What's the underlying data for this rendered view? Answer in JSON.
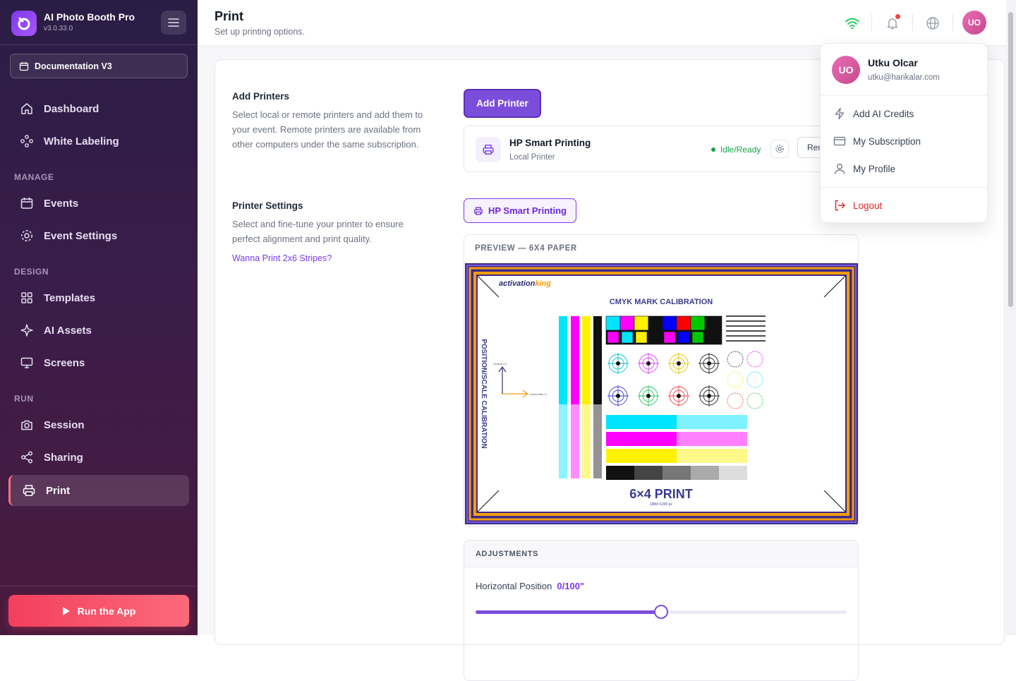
{
  "app": {
    "name": "AI Photo Booth Pro",
    "version": "v3.0.33.0"
  },
  "sidebar": {
    "project": "Documentation V3",
    "sections": {
      "manage": "MANAGE",
      "design": "DESIGN",
      "run": "RUN"
    },
    "items": [
      {
        "label": "Dashboard",
        "icon": "home-icon"
      },
      {
        "label": "White Labeling",
        "icon": "palette-icon"
      },
      {
        "label": "Events",
        "icon": "calendar-icon"
      },
      {
        "label": "Event Settings",
        "icon": "gear-icon"
      },
      {
        "label": "Templates",
        "icon": "grid-icon"
      },
      {
        "label": "AI Assets",
        "icon": "sparkle-icon"
      },
      {
        "label": "Screens",
        "icon": "monitor-icon"
      },
      {
        "label": "Session",
        "icon": "camera-icon"
      },
      {
        "label": "Sharing",
        "icon": "share-icon"
      },
      {
        "label": "Print",
        "icon": "printer-icon",
        "active": true
      }
    ],
    "run_button": "Run the App"
  },
  "header": {
    "title": "Print",
    "subtitle": "Set up printing options.",
    "avatar_initials": "UO"
  },
  "add_printers": {
    "title": "Add Printers",
    "description": "Select local or remote printers and add them to your event. Remote printers are available from other computers under the same subscription.",
    "button": "Add Printer"
  },
  "printer": {
    "name": "HP Smart Printing",
    "type": "Local Printer",
    "status": "Idle/Ready",
    "remove_label": "Remove"
  },
  "printer_settings": {
    "title": "Printer Settings",
    "description": "Select and fine-tune your printer to ensure perfect alignment and print quality.",
    "link": "Wanna Print 2x6 Stripes?",
    "selected_printer": "HP Smart Printing"
  },
  "preview": {
    "label": "PREVIEW — 6X4 PAPER",
    "brand_a": "activation",
    "brand_b": "king",
    "heading": "CMYK MARK CALIBRATION",
    "side_label": "POSITION/SCALE CALIBRATION",
    "vertical_label": "Vertical (+)",
    "horizontal_label": "Horizontal (+)",
    "print_title": "6×4 PRINT",
    "print_size": "1800×1200 px"
  },
  "adjustments": {
    "title": "ADJUSTMENTS",
    "horizontal_label": "Horizontal Position",
    "horizontal_value": "0/100\"",
    "slider_fraction": 0.5
  },
  "user_menu": {
    "initials": "UO",
    "name": "Utku Olcar",
    "email": "utku@harikalar.com",
    "items": [
      {
        "label": "Add AI Credits",
        "icon": "bolt-icon"
      },
      {
        "label": "My Subscription",
        "icon": "card-icon"
      },
      {
        "label": "My Profile",
        "icon": "user-icon"
      }
    ],
    "logout": "Logout"
  },
  "colors": {
    "accent": "#7c4ddb",
    "run": "#f43f5e",
    "status_ok": "#16a34a",
    "logout": "#dc2626"
  }
}
